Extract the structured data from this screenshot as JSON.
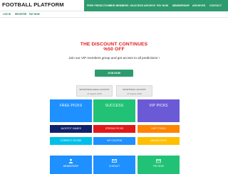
{
  "header": {
    "logo_text": "FOOTBALL PLATFORM",
    "nav": [
      {
        "label": "FREE PREDICTIONS",
        "has_dropdown": false
      },
      {
        "label": "FOR MEMBERS",
        "has_dropdown": true
      },
      {
        "label": "SUCCESS ARCHIVE",
        "has_dropdown": false
      },
      {
        "label": "PAY NOW",
        "has_dropdown": false
      },
      {
        "label": "MEMBERSHIP",
        "has_dropdown": false
      },
      {
        "label": "ARCHIVES",
        "has_dropdown": false
      },
      {
        "label": "CONTACT",
        "has_dropdown": false
      }
    ],
    "dropdown_glyph": "▼",
    "subnav": [
      {
        "label": "LOG IN"
      },
      {
        "label": "REGISTER"
      },
      {
        "label": "PAY NOW"
      }
    ]
  },
  "promo": {
    "line1": "THE DISCOUNT CONTINUES",
    "line2": "%50 OFF",
    "subtitle": "Join our VIP members group and get access to all predictions !",
    "join_label": "JOIN NOW"
  },
  "jackpots": [
    {
      "name": "SPORTPESA MEGA JACKPOT",
      "date": "11 August 2019"
    },
    {
      "name": "SPORTPESA JACKPOT",
      "date": "11 August 2019"
    }
  ],
  "pick_tiles": [
    {
      "label": "FREE PICKS",
      "color": "#1e90ff"
    },
    {
      "label": "SUCCESS",
      "color": "#21c275"
    },
    {
      "label": "VIP PICKS",
      "color": "#6a5ad6"
    }
  ],
  "category_tiles": [
    {
      "label": "JACKPOT GAMES",
      "color": "#10216b"
    },
    {
      "label": "STRONG PICKS",
      "color": "#e01818"
    },
    {
      "label": "HOFT PICKS",
      "color": "#ff8400"
    },
    {
      "label": "CORRECT SCORE",
      "color": "#00bfea"
    },
    {
      "label": "VIP COUPON",
      "color": "#1e90ff"
    },
    {
      "label": "UNDER-OVER",
      "color": "#ffc000"
    }
  ],
  "icon_tiles": [
    {
      "label": "MEMBERSHIP",
      "icon": "user-icon",
      "color": "#1e90ff"
    },
    {
      "label": "CONTACT",
      "icon": "envelope-icon",
      "color": "#1e90ff"
    },
    {
      "label": "PAY NOW",
      "icon": "card-icon",
      "color": "#21c275"
    }
  ],
  "colors": {
    "brand_green": "#2e9b6e",
    "promo_red": "#e01818"
  }
}
